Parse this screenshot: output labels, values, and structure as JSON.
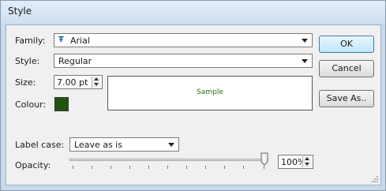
{
  "window": {
    "title": "Style"
  },
  "family": {
    "label": "Family:",
    "value": "Arial",
    "icon": "truetype-font-icon"
  },
  "style": {
    "label": "Style:",
    "value": "Regular"
  },
  "size": {
    "label": "Size:",
    "value": "7.00 pt"
  },
  "colour": {
    "label": "Colour:",
    "value": "#22530d"
  },
  "sample": {
    "text": "Sample",
    "color": "#2f6f14"
  },
  "buttons": {
    "ok": "OK",
    "cancel": "Cancel",
    "save_as": "Save As.."
  },
  "label_case": {
    "label": "Label case:",
    "value": "Leave as is"
  },
  "opacity": {
    "label": "Opacity:",
    "value": "100%",
    "level": 1.0
  }
}
